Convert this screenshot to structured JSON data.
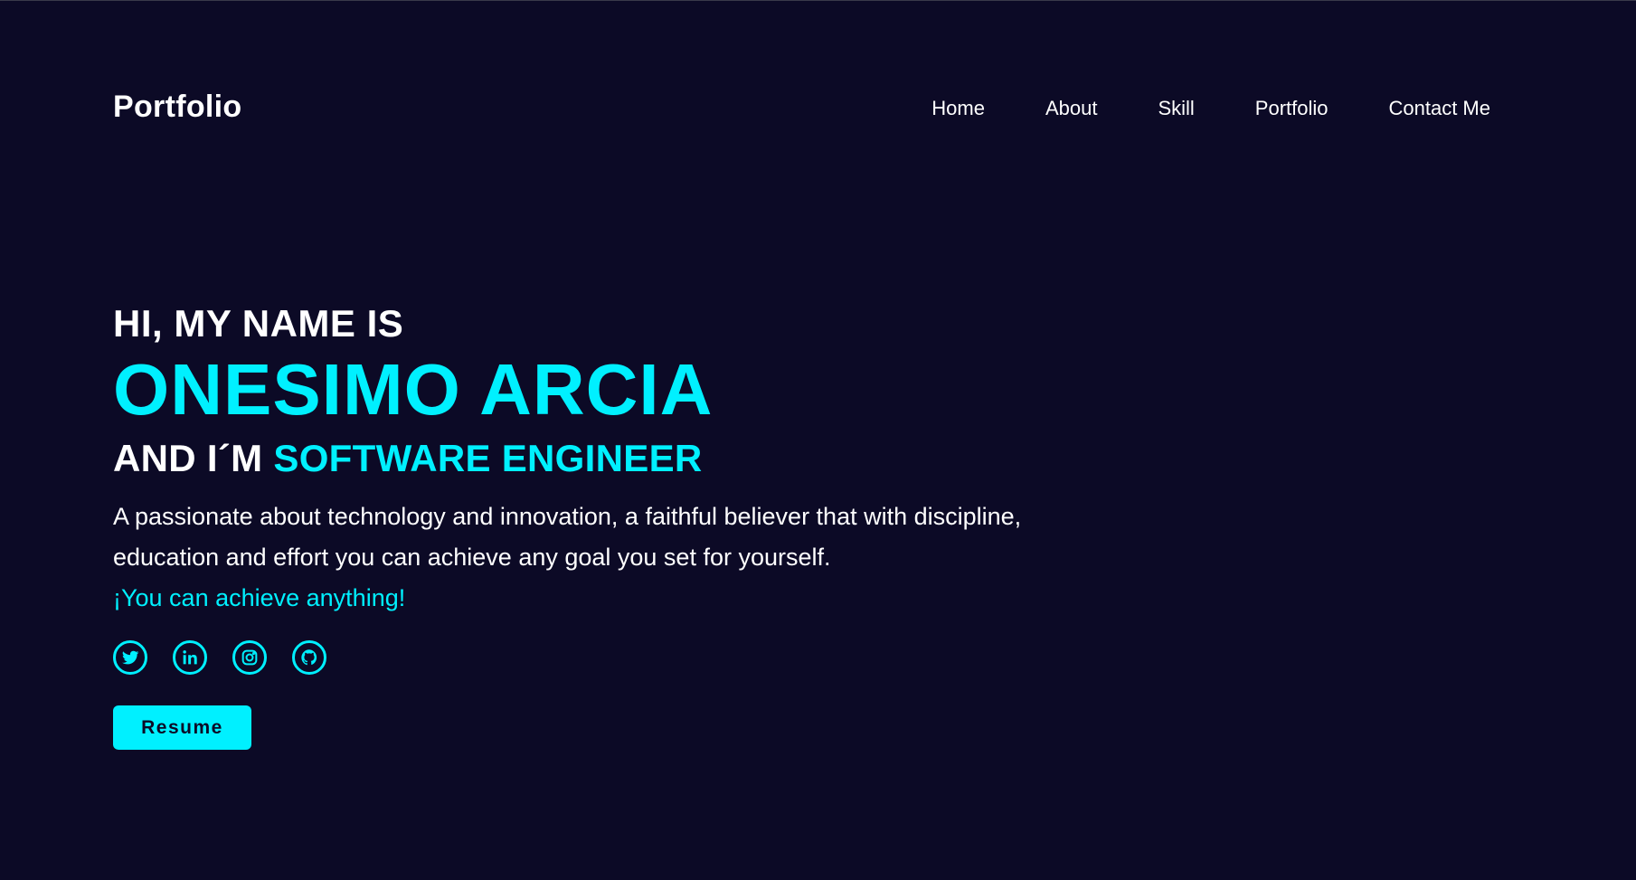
{
  "header": {
    "logo": "Portfolio",
    "nav": [
      "Home",
      "About",
      "Skill",
      "Portfolio",
      "Contact Me"
    ]
  },
  "hero": {
    "greeting": "HI, MY NAME IS",
    "name": "ONESIMO ARCIA",
    "role_prefix": "AND I´M ",
    "role_accent": "SOFTWARE ENGINEER",
    "description": "A passionate about technology and innovation, a faithful believer that with discipline, education and effort you can achieve any goal you set for yourself.",
    "tagline": "¡You can achieve anything!",
    "socials": [
      "twitter-icon",
      "linkedin-icon",
      "instagram-icon",
      "github-icon"
    ],
    "resume_label": "Resume"
  },
  "colors": {
    "background": "#0c0a26",
    "accent": "#00f0ff",
    "text": "#ffffff"
  }
}
